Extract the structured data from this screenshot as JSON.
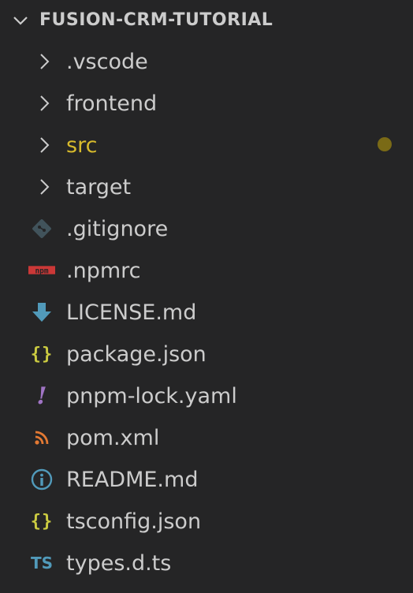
{
  "explorer": {
    "section_title": "FUSION-CRM-TUTORIAL",
    "items": [
      {
        "label": ".vscode",
        "type": "folder",
        "icon": "chevron-right-icon",
        "modified": false
      },
      {
        "label": "frontend",
        "type": "folder",
        "icon": "chevron-right-icon",
        "modified": false
      },
      {
        "label": "src",
        "type": "folder",
        "icon": "chevron-right-icon",
        "modified": true
      },
      {
        "label": "target",
        "type": "folder",
        "icon": "chevron-right-icon",
        "modified": false
      },
      {
        "label": ".gitignore",
        "type": "file",
        "icon": "git-icon",
        "modified": false
      },
      {
        "label": ".npmrc",
        "type": "file",
        "icon": "npm-icon",
        "modified": false
      },
      {
        "label": "LICENSE.md",
        "type": "file",
        "icon": "license-download-icon",
        "modified": false
      },
      {
        "label": "package.json",
        "type": "file",
        "icon": "json-braces-icon",
        "modified": false
      },
      {
        "label": "pnpm-lock.yaml",
        "type": "file",
        "icon": "yaml-exclamation-icon",
        "modified": false
      },
      {
        "label": "pom.xml",
        "type": "file",
        "icon": "rss-feed-icon",
        "modified": false
      },
      {
        "label": "README.md",
        "type": "file",
        "icon": "info-icon",
        "modified": false
      },
      {
        "label": "tsconfig.json",
        "type": "file",
        "icon": "json-braces-icon",
        "modified": false
      },
      {
        "label": "types.d.ts",
        "type": "file",
        "icon": "typescript-icon",
        "modified": false
      }
    ],
    "icon_text": {
      "npm": "npm",
      "braces": "{}",
      "yaml": "!",
      "ts": "TS"
    },
    "colors": {
      "background": "#252526",
      "text": "#cccccc",
      "modified_text": "#d7ba2c",
      "modified_dot": "#7a6a16",
      "json_icon": "#cbcb41",
      "yaml_icon": "#a074c4",
      "ts_icon": "#519aba",
      "npm_icon": "#cb3837",
      "xml_icon": "#e37933",
      "git_icon": "#41535b"
    }
  }
}
